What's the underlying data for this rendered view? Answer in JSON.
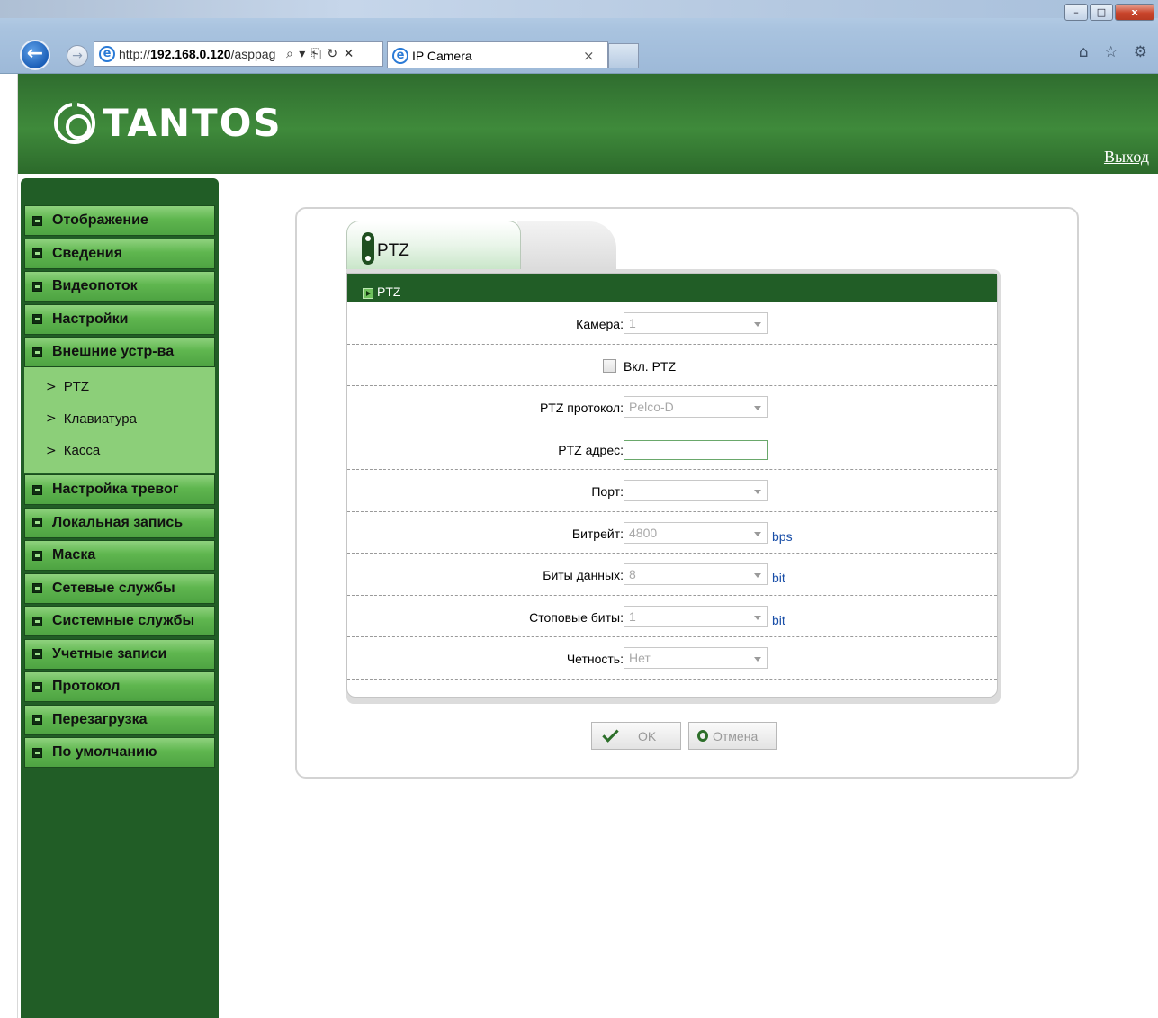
{
  "browser": {
    "url_prefix": "http://",
    "url_host": "192.168.0.120",
    "url_path": "/asppag",
    "address_tools": "⌕ ▾ ⎗ ↻ ✕",
    "tab_title": "IP Camera",
    "tab_close": "×",
    "window_min": "–",
    "window_max": "□",
    "window_close": "x",
    "back_icon_glyph": "←",
    "forward_icon_glyph": "→",
    "right_icons": "⌂ ☆ ⚙"
  },
  "header": {
    "logo_text": "TANTOS",
    "logout_label": "Выход"
  },
  "sidebar": {
    "items": [
      {
        "label": "Отображение"
      },
      {
        "label": "Сведения"
      },
      {
        "label": "Видеопоток"
      },
      {
        "label": "Настройки"
      },
      {
        "label": "Внешние устр-ва"
      },
      {
        "label": "Настройка тревог"
      },
      {
        "label": "Локальная запись"
      },
      {
        "label": "Маска"
      },
      {
        "label": "Сетевые службы"
      },
      {
        "label": "Системные службы"
      },
      {
        "label": "Учетные записи"
      },
      {
        "label": "Протокол"
      },
      {
        "label": "Перезагрузка"
      },
      {
        "label": "По умолчанию"
      }
    ],
    "submenu": [
      {
        "label": "PTZ"
      },
      {
        "label": "Клавиатура"
      },
      {
        "label": "Касса"
      }
    ],
    "submenu_chevron": ">"
  },
  "panel": {
    "tab_label": "PTZ",
    "section_title": "PTZ",
    "fields": {
      "camera": {
        "label": "Камера:",
        "value": "1"
      },
      "enable_ptz": {
        "label": "Вкл. PTZ",
        "checked": false
      },
      "protocol": {
        "label": "PTZ протокол:",
        "value": "Pelco-D"
      },
      "address": {
        "label": "PTZ адрес:",
        "value": ""
      },
      "port": {
        "label": "Порт:",
        "value": ""
      },
      "bitrate": {
        "label": "Битрейт:",
        "value": "4800",
        "unit": "bps"
      },
      "data_bits": {
        "label": "Биты данных:",
        "value": "8",
        "unit": "bit"
      },
      "stop_bits": {
        "label": "Стоповые биты:",
        "value": "1",
        "unit": "bit"
      },
      "parity": {
        "label": "Четность:",
        "value": "Нет"
      }
    },
    "ok_label": "OK",
    "cancel_label": "Отмена"
  },
  "colors": {
    "header_green": "#3f8a3b",
    "sidebar_green": "#215d26",
    "menu_light_green": "#5fb64f",
    "unit_blue": "#1a4fa8"
  }
}
